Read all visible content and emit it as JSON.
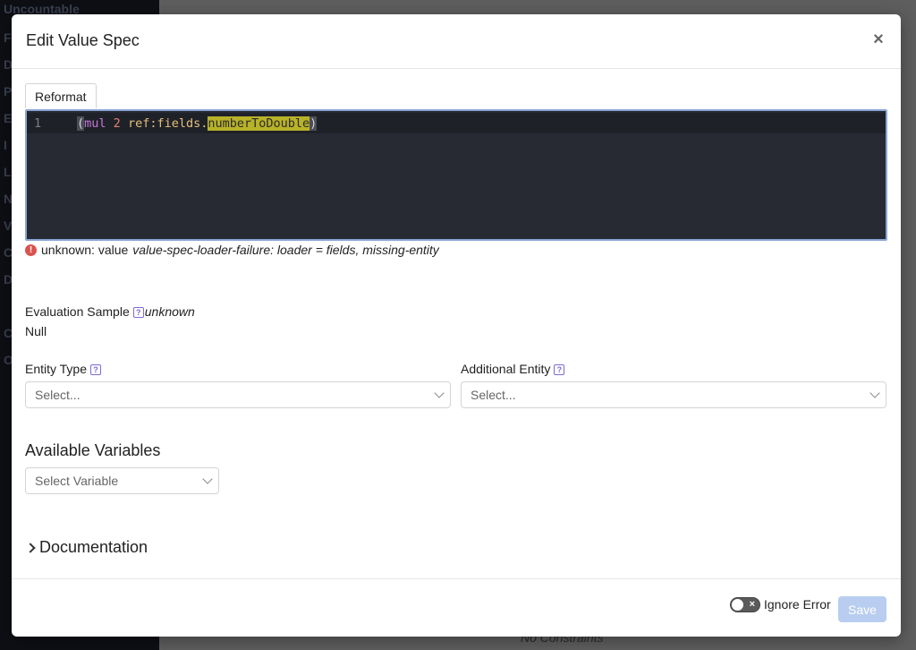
{
  "background": {
    "sidebar_lines": [
      "Uncountable",
      "F",
      "D",
      "P",
      "E",
      "I",
      "L",
      "N",
      "V",
      "C",
      "D",
      "C",
      "O"
    ],
    "footer_text": "No Constraints"
  },
  "modal": {
    "title": "Edit Value Spec",
    "close_label": "×"
  },
  "editor": {
    "reformat_label": "Reformat",
    "line_number": "1",
    "tokens": {
      "open_paren": "(",
      "fn": "mul",
      "num": "2",
      "ref": "ref:fields.",
      "highlight": "numberToDouble",
      "close_paren": ")"
    }
  },
  "error": {
    "icon": "!",
    "prefix": "unknown:  value",
    "detail": "value-spec-loader-failure: loader = fields, missing-entity"
  },
  "evaluation": {
    "label": "Evaluation Sample",
    "help": "?",
    "status": "unknown",
    "value": "Null"
  },
  "entity_type": {
    "label": "Entity Type",
    "help": "?",
    "placeholder": "Select..."
  },
  "additional_entity": {
    "label": "Additional Entity",
    "help": "?",
    "placeholder": "Select..."
  },
  "variables": {
    "title": "Available Variables",
    "placeholder": "Select Variable"
  },
  "documentation": {
    "label": "Documentation"
  },
  "footer": {
    "ignore_error_label": "Ignore Error",
    "toggle_off_mark": "×",
    "save_label": "Save"
  },
  "colors": {
    "editor_bg": "#272a33",
    "highlight": "#b8b228",
    "save_disabled": "#b9cdf0",
    "help_icon": "#7a6dd8",
    "error_icon": "#d9534f"
  }
}
